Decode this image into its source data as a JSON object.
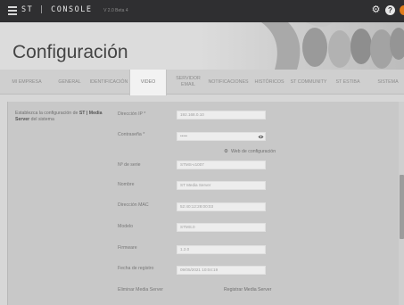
{
  "topbar": {
    "brand_prefix": "ST",
    "brand_sep": "|",
    "brand_name": "CONSOLE",
    "brand_sub": "V 2.0 Beta 4",
    "icons": [
      "menu-icon",
      "gear-icon",
      "help-icon",
      "user-avatar"
    ],
    "help_label": "?",
    "accent_color": "#e07b1a"
  },
  "page": {
    "title": "Configuración"
  },
  "tabs": [
    {
      "label": "MI EMPRESA",
      "active": false
    },
    {
      "label": "GENERAL",
      "active": false
    },
    {
      "label": "IDENTIFICACIÓN",
      "active": false
    },
    {
      "label": "VIDEO",
      "active": true
    },
    {
      "label": "SERVIDOR EMAIL",
      "active": false
    },
    {
      "label": "NOTIFICACIONES",
      "active": false
    },
    {
      "label": "HISTÓRICOS",
      "active": false
    },
    {
      "label": "ST COMMUNITY",
      "active": false
    },
    {
      "label": "ST ESTIBA",
      "active": false
    },
    {
      "label": "SISTEMA",
      "active": false
    }
  ],
  "panel": {
    "description_pre": "Establezca la configuración de ",
    "description_bold": "ST | Media Server",
    "description_post": " del sistema",
    "fields": {
      "ip": {
        "label": "Dirección IP *",
        "value": "192.168.0.10"
      },
      "password": {
        "label": "Contraseña *",
        "value": "•••••"
      },
      "web_link": "Web de configuración",
      "serial": {
        "label": "Nº de serie",
        "value": "STMS-v1007"
      },
      "name": {
        "label": "Nombre",
        "value": "ST Media Server"
      },
      "mac": {
        "label": "Dirección MAC",
        "value": "52:40:12:28:00:03"
      },
      "model": {
        "label": "Modelo",
        "value": "STMS.0"
      },
      "firmware": {
        "label": "Firmware",
        "value": "1.2.0"
      },
      "registration_date": {
        "label": "Fecha de registro",
        "value": "09/05/2021 10:04:19"
      },
      "unregister": {
        "label": "Eliminar Media Server",
        "value": "Registrar Media Server"
      }
    }
  }
}
